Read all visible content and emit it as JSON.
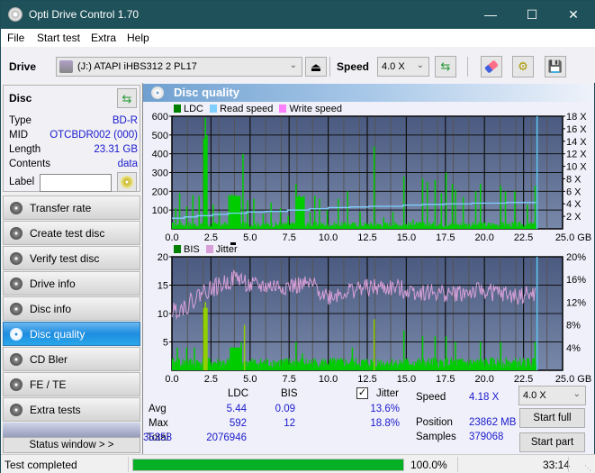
{
  "window": {
    "title": "Opti Drive Control 1.70",
    "minimize_icon": "minimize-icon",
    "maximize_icon": "maximize-icon",
    "close_icon": "close-icon"
  },
  "menu": {
    "items": [
      "File",
      "Start test",
      "Extra",
      "Help"
    ]
  },
  "toolbar": {
    "drive_label": "Drive",
    "drive_value": "(J:)  ATAPI iHBS312   2 PL17",
    "speed_label": "Speed",
    "speed_value": "4.0 X",
    "icons": [
      "drive-icon",
      "eject-icon",
      "refresh-icon",
      "eraser-icon",
      "settings-icon",
      "save-icon"
    ]
  },
  "disc": {
    "header": "Disc",
    "rows": [
      {
        "key": "Type",
        "value": "BD-R"
      },
      {
        "key": "MID",
        "value": "OTCBDR002 (000)"
      },
      {
        "key": "Length",
        "value": "23.31 GB"
      },
      {
        "key": "Contents",
        "value": "data"
      }
    ],
    "label_key": "Label",
    "label_value": ""
  },
  "nav": {
    "items": [
      {
        "label": "Transfer rate",
        "active": false
      },
      {
        "label": "Create test disc",
        "active": false
      },
      {
        "label": "Verify test disc",
        "active": false
      },
      {
        "label": "Drive info",
        "active": false
      },
      {
        "label": "Disc info",
        "active": false
      },
      {
        "label": "Disc quality",
        "active": true
      },
      {
        "label": "CD Bler",
        "active": false
      },
      {
        "label": "FE / TE",
        "active": false
      },
      {
        "label": "Extra tests",
        "active": false
      }
    ],
    "status_window_label": "Status window > >"
  },
  "section": {
    "title": "Disc quality"
  },
  "colors": {
    "ldc": "#008000",
    "ldc_bar": "#00cc00",
    "read_speed": "#80d0ff",
    "write_speed": "#ff80ff",
    "bis": "#008000",
    "jitter": "#d8a0d8",
    "plot_bg_top": "#4a5a80",
    "plot_bg_bottom": "#7888aa",
    "accent_nav": "#1e8de0",
    "progress": "#06b025"
  },
  "chart_data": [
    {
      "type": "bar",
      "title": "LDC / Read speed",
      "legend": [
        "LDC",
        "Read speed",
        "Write speed"
      ],
      "legend_placement": "top-left",
      "xlabel": "GB",
      "x_ticks": [
        "0.0",
        "2.5",
        "5.0",
        "7.5",
        "10.0",
        "12.5",
        "15.0",
        "17.5",
        "20.0",
        "22.5",
        "25.0 GB"
      ],
      "xlim": [
        0,
        25
      ],
      "y_left_ticks": [
        "600",
        "500",
        "400",
        "300",
        "200",
        "100"
      ],
      "ylim_left": [
        0,
        600
      ],
      "y_right_ticks": [
        "18 X",
        "16 X",
        "14 X",
        "12 X",
        "10 X",
        "8 X",
        "6 X",
        "4 X",
        "2 X"
      ],
      "ylim_right": [
        0,
        18
      ],
      "grid": true,
      "end_marker_gb": 23.31,
      "ldc_spikes": [
        {
          "x": 0.2,
          "y": 110
        },
        {
          "x": 0.45,
          "y": 190
        },
        {
          "x": 0.9,
          "y": 120
        },
        {
          "x": 1.3,
          "y": 180
        },
        {
          "x": 1.7,
          "y": 175
        },
        {
          "x": 2.05,
          "y": 480
        },
        {
          "x": 2.1,
          "y": 592
        },
        {
          "x": 2.2,
          "y": 500
        },
        {
          "x": 2.6,
          "y": 130
        },
        {
          "x": 3.0,
          "y": 90
        },
        {
          "x": 3.6,
          "y": 180
        },
        {
          "x": 3.8,
          "y": 185
        },
        {
          "x": 4.0,
          "y": 180
        },
        {
          "x": 4.2,
          "y": 175
        },
        {
          "x": 4.5,
          "y": 400
        },
        {
          "x": 4.8,
          "y": 150
        },
        {
          "x": 5.2,
          "y": 160
        },
        {
          "x": 5.8,
          "y": 80
        },
        {
          "x": 6.3,
          "y": 140
        },
        {
          "x": 6.9,
          "y": 110
        },
        {
          "x": 7.4,
          "y": 70
        },
        {
          "x": 7.9,
          "y": 240
        },
        {
          "x": 8.1,
          "y": 180
        },
        {
          "x": 8.4,
          "y": 175
        },
        {
          "x": 8.8,
          "y": 90
        },
        {
          "x": 9.1,
          "y": 175
        },
        {
          "x": 9.4,
          "y": 160
        },
        {
          "x": 9.9,
          "y": 100
        },
        {
          "x": 10.6,
          "y": 160
        },
        {
          "x": 11.2,
          "y": 200
        },
        {
          "x": 12.0,
          "y": 90
        },
        {
          "x": 12.9,
          "y": 440
        },
        {
          "x": 13.5,
          "y": 60
        },
        {
          "x": 14.1,
          "y": 90
        },
        {
          "x": 14.8,
          "y": 280
        },
        {
          "x": 15.4,
          "y": 50
        },
        {
          "x": 16.0,
          "y": 270
        },
        {
          "x": 16.3,
          "y": 250
        },
        {
          "x": 16.8,
          "y": 260
        },
        {
          "x": 17.2,
          "y": 190
        },
        {
          "x": 17.5,
          "y": 300
        },
        {
          "x": 17.9,
          "y": 240
        },
        {
          "x": 18.1,
          "y": 210
        },
        {
          "x": 18.6,
          "y": 170
        },
        {
          "x": 19.4,
          "y": 200
        },
        {
          "x": 19.7,
          "y": 240
        },
        {
          "x": 21.0,
          "y": 230
        },
        {
          "x": 21.3,
          "y": 200
        },
        {
          "x": 21.9,
          "y": 200
        },
        {
          "x": 22.7,
          "y": 130
        },
        {
          "x": 23.2,
          "y": 230
        }
      ],
      "ldc_baseline": 25,
      "read_speed_steps": [
        {
          "x": 0.0,
          "y": 1.7
        },
        {
          "x": 0.8,
          "y": 1.9
        },
        {
          "x": 1.6,
          "y": 2.1
        },
        {
          "x": 2.6,
          "y": 2.3
        },
        {
          "x": 3.6,
          "y": 2.5
        },
        {
          "x": 4.8,
          "y": 2.7
        },
        {
          "x": 6.0,
          "y": 2.8
        },
        {
          "x": 7.4,
          "y": 3.0
        },
        {
          "x": 8.8,
          "y": 3.2
        },
        {
          "x": 10.0,
          "y": 3.4
        },
        {
          "x": 11.4,
          "y": 3.5
        },
        {
          "x": 12.6,
          "y": 3.6
        },
        {
          "x": 14.8,
          "y": 3.8
        },
        {
          "x": 16.0,
          "y": 3.9
        },
        {
          "x": 17.5,
          "y": 4.0
        },
        {
          "x": 19.2,
          "y": 4.1
        },
        {
          "x": 21.4,
          "y": 4.2
        },
        {
          "x": 23.31,
          "y": 4.2
        }
      ]
    },
    {
      "type": "bar",
      "title": "BIS / Jitter",
      "legend": [
        "BIS",
        "Jitter"
      ],
      "legend_placement": "top-left",
      "xlabel": "GB",
      "x_ticks": [
        "0.0",
        "2.5",
        "5.0",
        "7.5",
        "10.0",
        "12.5",
        "15.0",
        "17.5",
        "20.0",
        "22.5",
        "25.0 GB"
      ],
      "xlim": [
        0,
        25
      ],
      "y_left_ticks": [
        "20",
        "15",
        "10",
        "5"
      ],
      "ylim_left": [
        0,
        20
      ],
      "y_right_ticks": [
        "20%",
        "16%",
        "12%",
        "8%",
        "4%"
      ],
      "ylim_right": [
        0,
        20
      ],
      "grid": true,
      "end_marker_gb": 23.31,
      "bis_spikes": [
        {
          "x": 0.3,
          "y": 4
        },
        {
          "x": 0.9,
          "y": 4
        },
        {
          "x": 1.4,
          "y": 4
        },
        {
          "x": 2.05,
          "y": 11
        },
        {
          "x": 2.1,
          "y": 12
        },
        {
          "x": 2.2,
          "y": 11
        },
        {
          "x": 3.8,
          "y": 4
        },
        {
          "x": 4.1,
          "y": 4
        },
        {
          "x": 4.4,
          "y": 5
        },
        {
          "x": 4.6,
          "y": 8
        },
        {
          "x": 7.9,
          "y": 5
        },
        {
          "x": 8.3,
          "y": 3
        },
        {
          "x": 11.5,
          "y": 4
        },
        {
          "x": 12.9,
          "y": 9
        },
        {
          "x": 14.8,
          "y": 7
        },
        {
          "x": 16.0,
          "y": 6
        },
        {
          "x": 16.8,
          "y": 6
        },
        {
          "x": 17.5,
          "y": 6
        },
        {
          "x": 18.1,
          "y": 5
        },
        {
          "x": 19.7,
          "y": 5
        },
        {
          "x": 21.0,
          "y": 5
        },
        {
          "x": 23.2,
          "y": 5
        }
      ],
      "bis_baseline": 1.5,
      "jitter_trend": [
        {
          "x": 0.0,
          "y": 10.5
        },
        {
          "x": 1.0,
          "y": 11.5
        },
        {
          "x": 2.0,
          "y": 14.0
        },
        {
          "x": 3.0,
          "y": 14.8
        },
        {
          "x": 4.2,
          "y": 16.5
        },
        {
          "x": 5.0,
          "y": 14.8
        },
        {
          "x": 7.0,
          "y": 14.8
        },
        {
          "x": 9.0,
          "y": 15.0
        },
        {
          "x": 10.0,
          "y": 13.0
        },
        {
          "x": 12.0,
          "y": 14.5
        },
        {
          "x": 14.0,
          "y": 14.5
        },
        {
          "x": 16.0,
          "y": 13.8
        },
        {
          "x": 18.0,
          "y": 13.5
        },
        {
          "x": 20.0,
          "y": 14.0
        },
        {
          "x": 22.0,
          "y": 13.0
        },
        {
          "x": 23.31,
          "y": 13.5
        }
      ]
    }
  ],
  "stats": {
    "col_ldc": "LDC",
    "col_bis": "BIS",
    "jitter_label": "Jitter",
    "jitter_checked": true,
    "avg_label": "Avg",
    "max_label": "Max",
    "total_label": "Total",
    "ldc_avg": "5.44",
    "ldc_max": "592",
    "ldc_total": "2076946",
    "bis_avg": "0.09",
    "bis_max": "12",
    "bis_total": "35358",
    "jitter_avg": "13.6%",
    "jitter_max": "18.8%",
    "speed_label": "Speed",
    "speed_value": "4.18 X",
    "position_label": "Position",
    "position_value": "23862 MB",
    "samples_label": "Samples",
    "samples_value": "379068",
    "speed_select": "4.0 X",
    "start_full_label": "Start full",
    "start_part_label": "Start part"
  },
  "statusbar": {
    "status_text": "Test completed",
    "progress_fraction": 1.0,
    "progress_text": "100.0%",
    "time": "33:14"
  }
}
